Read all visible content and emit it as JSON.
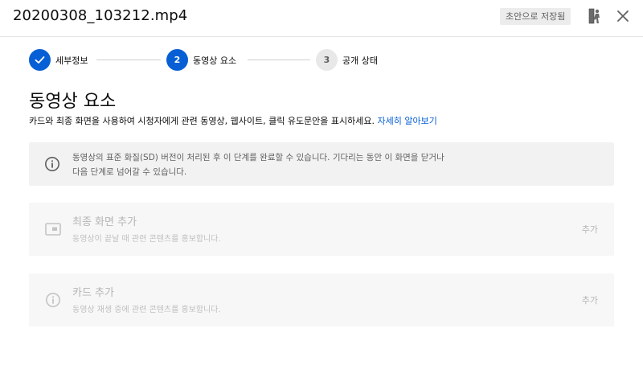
{
  "header": {
    "title": "20200308_103212.mp4",
    "draft_badge": "초안으로 저장됨",
    "icons": {
      "alert": "alert-figure-icon",
      "close": "close-icon"
    }
  },
  "stepper": {
    "steps": [
      {
        "number": "",
        "label": "세부정보",
        "state": "done"
      },
      {
        "number": "2",
        "label": "동영상 요소",
        "state": "active"
      },
      {
        "number": "3",
        "label": "공개 상태",
        "state": "todo"
      }
    ]
  },
  "section": {
    "title": "동영상 요소",
    "description": "카드와 최종 화면을 사용하여 시청자에게 관련 동영상, 웹사이트, 클릭 유도문안을 표시하세요.",
    "learn_more": "자세히 알아보기"
  },
  "info_banner": {
    "line1": "동영상의 표준 화질(SD) 버전이 처리된 후 이 단계를 완료할 수 있습니다. 기다리는 동안 이 화면을 닫거나",
    "line2": "다음 단계로 넘어갈 수 있습니다."
  },
  "cards": [
    {
      "title": "최종 화면 추가",
      "subtitle": "동영상이 끝날 때 관련 콘텐츠를 홍보합니다.",
      "action": "추가",
      "icon": "end-screen-icon"
    },
    {
      "title": "카드 추가",
      "subtitle": "동영상 재생 중에 관련 콘텐츠를 홍보합니다.",
      "action": "추가",
      "icon": "info-icon"
    }
  ],
  "colors": {
    "accent": "#065fd4",
    "muted": "#b5b5b5",
    "banner_bg": "#f2f2f2",
    "card_bg": "#f7f7f7"
  }
}
